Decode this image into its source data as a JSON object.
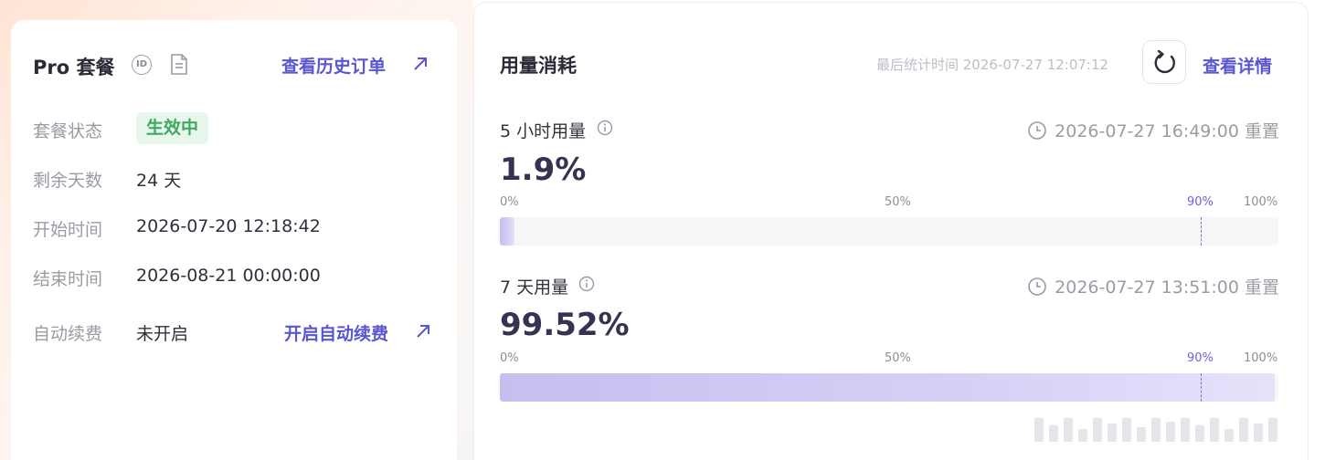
{
  "plan": {
    "title": "Pro 套餐",
    "history_link": "查看历史订单",
    "rows": [
      {
        "label": "套餐状态",
        "value": "生效中"
      },
      {
        "label": "剩余天数",
        "value": "24 天"
      },
      {
        "label": "开始时间",
        "value": "2026-07-20 12:18:42"
      },
      {
        "label": "结束时间",
        "value": "2026-08-21 00:00:00"
      },
      {
        "label": "自动续费",
        "value": "未开启"
      }
    ],
    "auto_renew_link": "开启自动续费",
    "status_color": "#3daa63"
  },
  "usage": {
    "title": "用量消耗",
    "last_stat": "最后统计时间 2026-07-27 12:07:12",
    "detail_link": "查看详情",
    "accent": "#5a55d2",
    "sections": [
      {
        "label": "5 小时用量",
        "reset": "2026-07-27 16:49:00 重置",
        "percent_text": "1.9%",
        "percent": 1.9,
        "ticks": [
          "0%",
          "50%",
          "90%",
          "100%"
        ]
      },
      {
        "label": "7 天用量",
        "reset": "2026-07-27 13:51:00 重置",
        "percent_text": "99.52%",
        "percent": 99.52,
        "ticks": [
          "0%",
          "50%",
          "90%",
          "100%"
        ]
      }
    ]
  }
}
